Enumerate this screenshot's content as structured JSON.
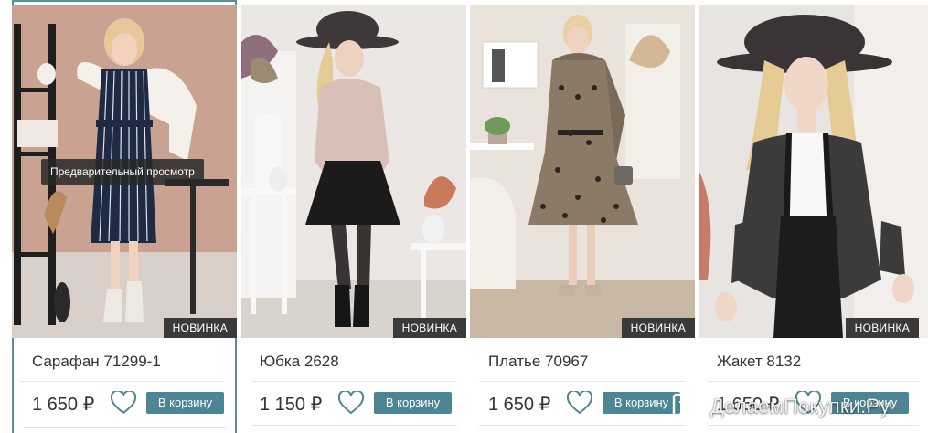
{
  "quick_view_label": "Предварительный просмотр",
  "colors": {
    "accent": "#4c8593",
    "badge_bg": "#3a3a3a",
    "selected_border": "#5b8f9c"
  },
  "products": [
    {
      "name": "Сарафан 71299-1",
      "price": "1 650 ₽",
      "badge": "НОВИНКА",
      "cart_label": "В корзину"
    },
    {
      "name": "Юбка 2628",
      "price": "1 150 ₽",
      "badge": "НОВИНКА",
      "cart_label": "В корзину"
    },
    {
      "name": "Платье 70967",
      "price": "1 650 ₽",
      "badge": "НОВИНКА",
      "cart_label": "В корзину"
    },
    {
      "name": "Жакет 8132",
      "price": "1 650 ₽",
      "badge": "НОВИНКА",
      "cart_label": "В корзину"
    }
  ],
  "watermark": {
    "text": "ДелаемПокупки.Ру",
    "icon": "cart-logo-icon"
  }
}
